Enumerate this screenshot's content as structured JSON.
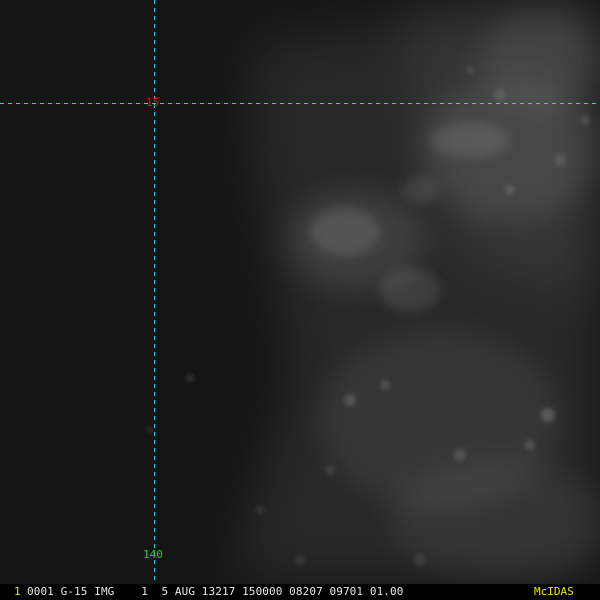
{
  "image": {
    "subject": "geostationary satellite visible-channel image of convective cloud field over dark ocean",
    "colors": {
      "ocean": "#141414",
      "cloud": "#d8d8d8",
      "gridline": "#3ad0d8",
      "lat_label": "#e01818",
      "lon_label": "#18d818",
      "caption_text": "#e8e8e8",
      "frame_number": "#e8e800",
      "brand": "#e8e800"
    }
  },
  "grid": {
    "latitude_label": "15",
    "longitude_label": "140"
  },
  "caption": {
    "frame_number": "1",
    "text": "0001 G-15 IMG    1  5 AUG 13217 150000 08207 09701 01.00",
    "brand": "McIDAS"
  }
}
